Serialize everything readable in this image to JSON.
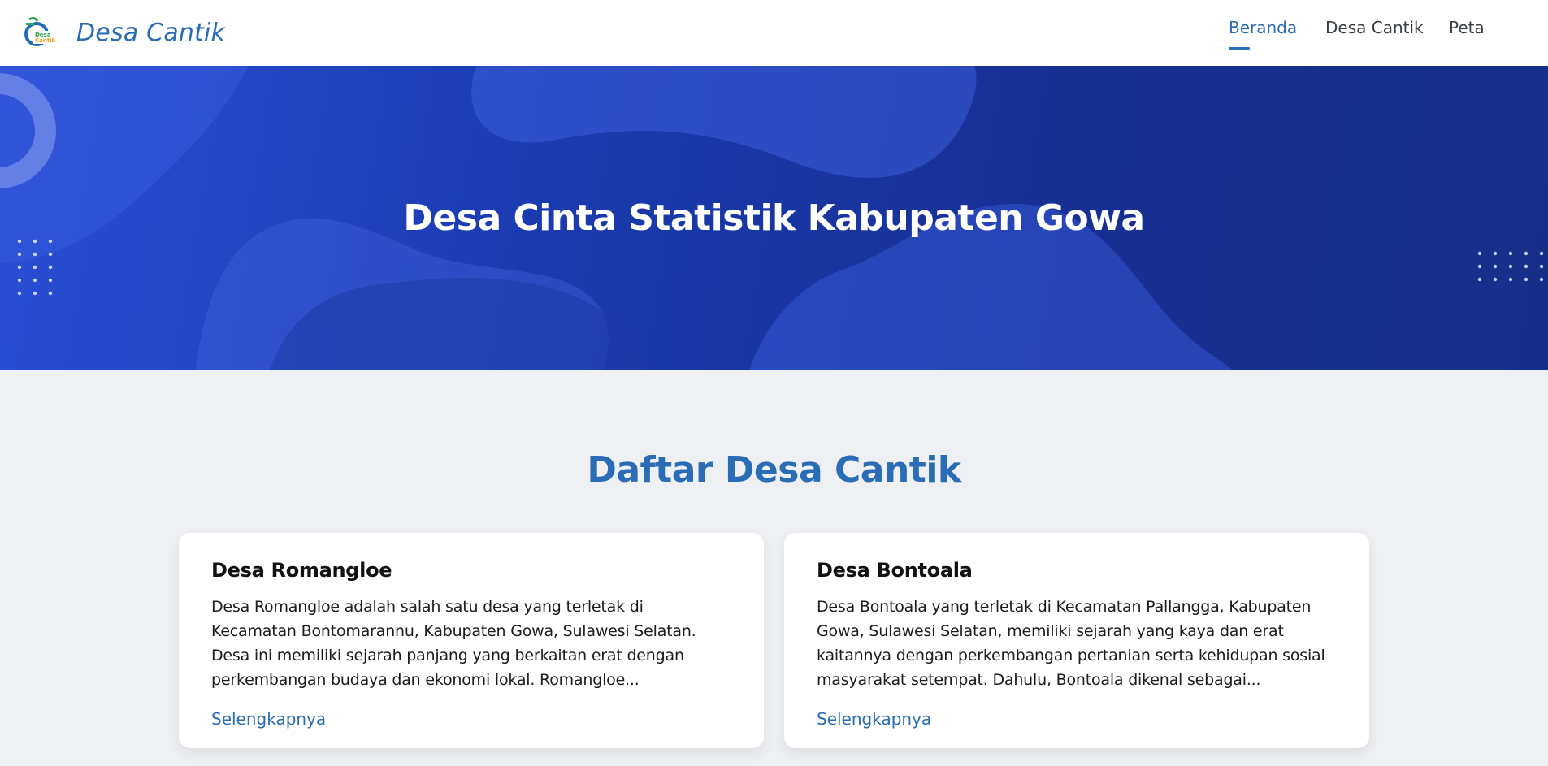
{
  "brand": {
    "logo_text_top": "Desa",
    "logo_text_bottom": "Cantik",
    "name": "Desa Cantik"
  },
  "nav": {
    "items": [
      {
        "label": "Beranda",
        "active": true
      },
      {
        "label": "Desa Cantik",
        "active": false
      },
      {
        "label": "Peta",
        "active": false
      }
    ]
  },
  "hero": {
    "title": "Desa Cinta Statistik Kabupaten Gowa"
  },
  "section": {
    "title": "Daftar Desa Cantik",
    "cards": [
      {
        "title": "Desa Romangloe",
        "description": "Desa Romangloe adalah salah satu desa yang terletak di Kecamatan Bontomarannu, Kabupaten Gowa, Sulawesi Selatan. Desa ini memiliki sejarah panjang yang berkaitan erat dengan perkembangan budaya dan ekonomi lokal. Romangloe...",
        "link": "Selengkapnya"
      },
      {
        "title": "Desa Bontoala",
        "description": "Desa Bontoala yang terletak di Kecamatan Pallangga, Kabupaten Gowa, Sulawesi Selatan, memiliki sejarah yang kaya dan erat kaitannya dengan perkembangan pertanian serta kehidupan sosial masyarakat setempat. Dahulu, Bontoala dikenal sebagai...",
        "link": "Selengkapnya"
      }
    ]
  },
  "colors": {
    "accent": "#2a6cb5",
    "hero_dark": "#16308a",
    "hero_light": "#2a4ed6",
    "page_bg": "#eef0f3"
  }
}
